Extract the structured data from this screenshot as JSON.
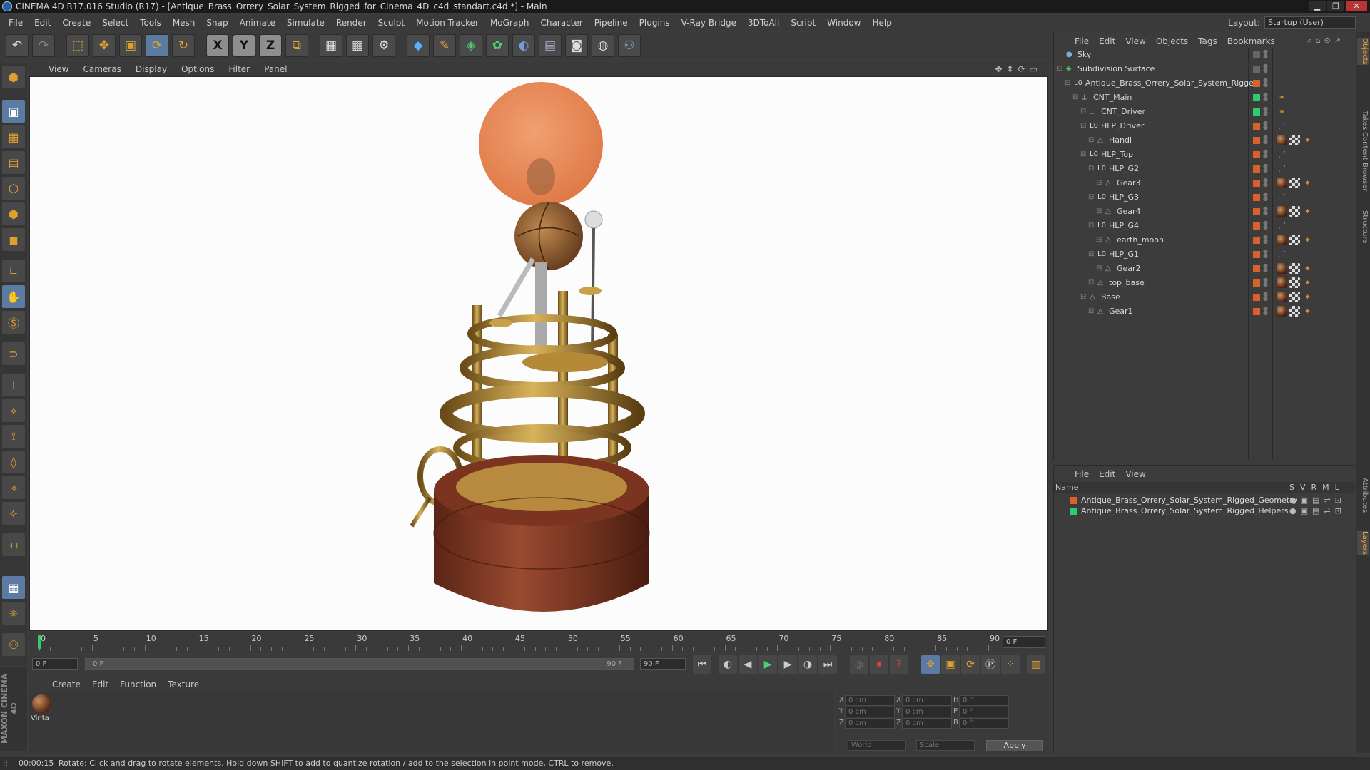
{
  "window": {
    "title": "CINEMA 4D R17.016 Studio (R17) - [Antique_Brass_Orrery_Solar_System_Rigged_for_Cinema_4D_c4d_standart.c4d *] - Main"
  },
  "menubar": [
    "File",
    "Edit",
    "Create",
    "Select",
    "Tools",
    "Mesh",
    "Snap",
    "Animate",
    "Simulate",
    "Render",
    "Sculpt",
    "Motion Tracker",
    "MoGraph",
    "Character",
    "Pipeline",
    "Plugins",
    "V-Ray Bridge",
    "3DToAll",
    "Script",
    "Window",
    "Help"
  ],
  "layout": {
    "label": "Layout:",
    "value": "Startup (User)"
  },
  "viewport_menu": [
    "View",
    "Cameras",
    "Display",
    "Options",
    "Filter",
    "Panel"
  ],
  "timeline": {
    "ticks": [
      "0",
      "5",
      "10",
      "15",
      "20",
      "25",
      "30",
      "35",
      "40",
      "45",
      "50",
      "55",
      "60",
      "65",
      "70",
      "75",
      "80",
      "85",
      "90"
    ],
    "current_frame": "0 F"
  },
  "transport": {
    "start": "0 F",
    "range_start": "0 F",
    "range_end": "90 F",
    "end": "90 F"
  },
  "material_menu": [
    "Create",
    "Edit",
    "Function",
    "Texture"
  ],
  "material": {
    "name": "Vinta"
  },
  "coords": {
    "rows": [
      {
        "axis": "X",
        "pos": "0 cm",
        "axis2": "X",
        "size": "0 cm",
        "axis3": "H",
        "rot": "0 °"
      },
      {
        "axis": "Y",
        "pos": "0 cm",
        "axis2": "Y",
        "size": "0 cm",
        "axis3": "P",
        "rot": "0 °"
      },
      {
        "axis": "Z",
        "pos": "0 cm",
        "axis2": "Z",
        "size": "0 cm",
        "axis3": "B",
        "rot": "0 °"
      }
    ],
    "world": "World",
    "scale": "Scale",
    "apply": "Apply"
  },
  "status": {
    "time": "00:00:15",
    "message": "Rotate: Click and drag to rotate elements. Hold down SHIFT to add to quantize rotation / add to the selection in point mode, CTRL to remove."
  },
  "object_menu": [
    "File",
    "Edit",
    "View",
    "Objects",
    "Tags",
    "Bookmarks"
  ],
  "objects": [
    {
      "name": "Sky",
      "indent": 0,
      "layer": "",
      "icon": "sky",
      "tags": []
    },
    {
      "name": "Subdivision Surface",
      "indent": 0,
      "layer": "",
      "icon": "subd",
      "tags": []
    },
    {
      "name": "Antique_Brass_Orrery_Solar_System_Rigged",
      "indent": 1,
      "layer": "#d9622b",
      "icon": "null",
      "tags": []
    },
    {
      "name": "CNT_Main",
      "indent": 2,
      "layer": "#2ecc71",
      "icon": "joint",
      "tags": [
        "ik"
      ]
    },
    {
      "name": "CNT_Driver",
      "indent": 3,
      "layer": "#2ecc71",
      "icon": "joint",
      "tags": [
        "ik"
      ]
    },
    {
      "name": "HLP_Driver",
      "indent": 3,
      "layer": "#d9622b",
      "icon": "null",
      "tags": [
        "dots"
      ]
    },
    {
      "name": "Handl",
      "indent": 4,
      "layer": "#d9622b",
      "icon": "poly",
      "tags": [
        "mat",
        "chk",
        "ik"
      ]
    },
    {
      "name": "HLP_Top",
      "indent": 3,
      "layer": "#d9622b",
      "icon": "null",
      "tags": [
        "dots"
      ]
    },
    {
      "name": "HLP_G2",
      "indent": 4,
      "layer": "#d9622b",
      "icon": "null",
      "tags": [
        "dots"
      ]
    },
    {
      "name": "Gear3",
      "indent": 5,
      "layer": "#d9622b",
      "icon": "poly",
      "tags": [
        "mat",
        "chk",
        "ik"
      ]
    },
    {
      "name": "HLP_G3",
      "indent": 4,
      "layer": "#d9622b",
      "icon": "null",
      "tags": [
        "dots"
      ]
    },
    {
      "name": "Gear4",
      "indent": 5,
      "layer": "#d9622b",
      "icon": "poly",
      "tags": [
        "mat",
        "chk",
        "ik"
      ]
    },
    {
      "name": "HLP_G4",
      "indent": 4,
      "layer": "#d9622b",
      "icon": "null",
      "tags": [
        "dots"
      ]
    },
    {
      "name": "earth_moon",
      "indent": 5,
      "layer": "#d9622b",
      "icon": "poly",
      "tags": [
        "mat",
        "chk",
        "ik"
      ]
    },
    {
      "name": "HLP_G1",
      "indent": 4,
      "layer": "#d9622b",
      "icon": "null",
      "tags": [
        "dots"
      ]
    },
    {
      "name": "Gear2",
      "indent": 5,
      "layer": "#d9622b",
      "icon": "poly",
      "tags": [
        "mat",
        "chk",
        "ik"
      ]
    },
    {
      "name": "top_base",
      "indent": 4,
      "layer": "#d9622b",
      "icon": "poly",
      "tags": [
        "mat",
        "chk",
        "ik"
      ]
    },
    {
      "name": "Base",
      "indent": 3,
      "layer": "#d9622b",
      "icon": "poly",
      "tags": [
        "mat",
        "chk",
        "ik"
      ]
    },
    {
      "name": "Gear1",
      "indent": 4,
      "layer": "#d9622b",
      "icon": "poly",
      "tags": [
        "mat",
        "chk",
        "ik"
      ]
    }
  ],
  "layer_menu": [
    "File",
    "Edit",
    "View"
  ],
  "layer_header": {
    "name": "Name",
    "cols": [
      "S",
      "V",
      "R",
      "M",
      "L"
    ]
  },
  "layers": [
    {
      "name": "Antique_Brass_Orrery_Solar_System_Rigged_Geometry",
      "color": "#d9622b"
    },
    {
      "name": "Antique_Brass_Orrery_Solar_System_Rigged_Helpers",
      "color": "#2ecc71"
    }
  ],
  "side_tabs": [
    "Objects",
    "Takes",
    "Content Browser",
    "Structure",
    "Attributes",
    "Layers"
  ],
  "colors": {
    "accent": "#e6a640",
    "selected": "#5b7ba3",
    "viewport_bg": "#fcfcfc"
  }
}
